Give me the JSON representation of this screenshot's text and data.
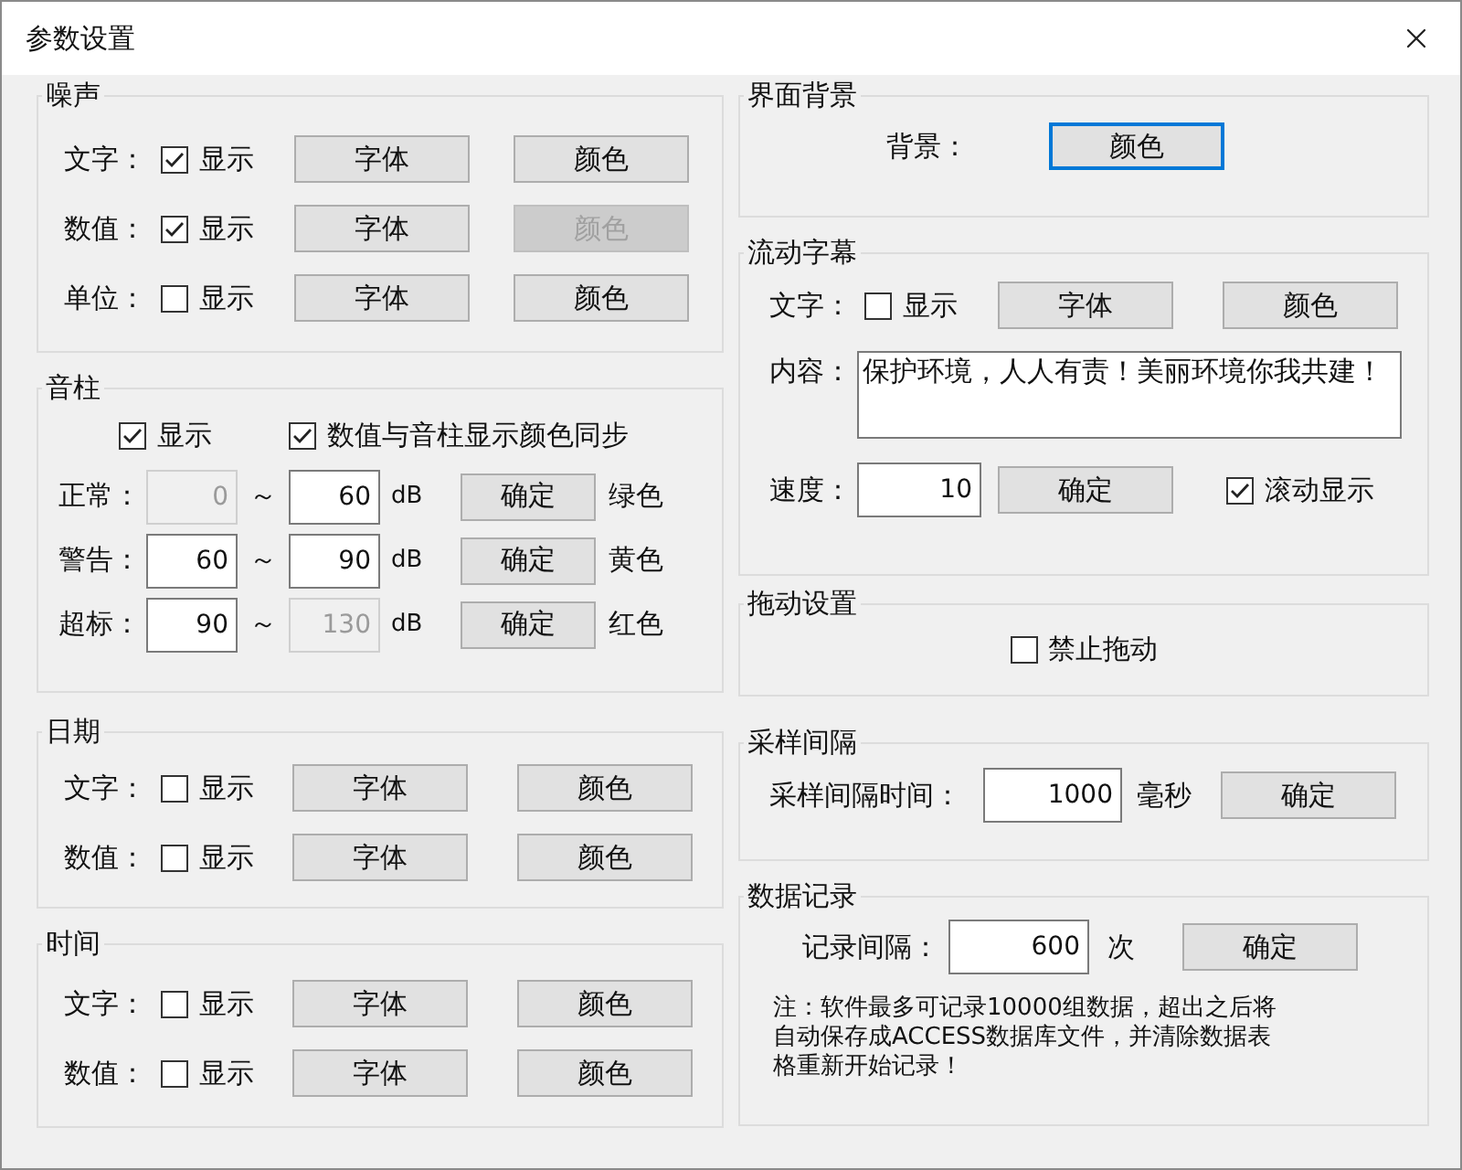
{
  "window": {
    "title": "参数设置"
  },
  "noise": {
    "title": "噪声",
    "rows": [
      {
        "label": "文字：",
        "show": {
          "label": "显示",
          "checked": true
        },
        "font_button": {
          "label": "字体",
          "disabled": false
        },
        "color_button": {
          "label": "颜色",
          "disabled": false
        }
      },
      {
        "label": "数值：",
        "show": {
          "label": "显示",
          "checked": true
        },
        "font_button": {
          "label": "字体",
          "disabled": false
        },
        "color_button": {
          "label": "颜色",
          "disabled": true
        }
      },
      {
        "label": "单位：",
        "show": {
          "label": "显示",
          "checked": false
        },
        "font_button": {
          "label": "字体",
          "disabled": false
        },
        "color_button": {
          "label": "颜色",
          "disabled": false
        }
      }
    ]
  },
  "bar": {
    "title": "音柱",
    "show": {
      "label": "显示",
      "checked": true
    },
    "sync": {
      "label": "数值与音柱显示颜色同步",
      "checked": true
    },
    "ranges": [
      {
        "label": "正常：",
        "low": {
          "value": "0",
          "disabled": true
        },
        "separator": "～",
        "high": {
          "value": "60",
          "disabled": false
        },
        "unit": "dB",
        "button": "确定",
        "color_name": "绿色"
      },
      {
        "label": "警告：",
        "low": {
          "value": "60",
          "disabled": false
        },
        "separator": "～",
        "high": {
          "value": "90",
          "disabled": false
        },
        "unit": "dB",
        "button": "确定",
        "color_name": "黄色"
      },
      {
        "label": "超标：",
        "low": {
          "value": "90",
          "disabled": false
        },
        "separator": "～",
        "high": {
          "value": "130",
          "disabled": true
        },
        "unit": "dB",
        "button": "确定",
        "color_name": "红色"
      }
    ]
  },
  "date": {
    "title": "日期",
    "rows": [
      {
        "label": "文字：",
        "show": {
          "label": "显示",
          "checked": false
        },
        "font_button": {
          "label": "字体",
          "disabled": false
        },
        "color_button": {
          "label": "颜色",
          "disabled": false
        }
      },
      {
        "label": "数值：",
        "show": {
          "label": "显示",
          "checked": false
        },
        "font_button": {
          "label": "字体",
          "disabled": false
        },
        "color_button": {
          "label": "颜色",
          "disabled": false
        }
      }
    ]
  },
  "time": {
    "title": "时间",
    "rows": [
      {
        "label": "文字：",
        "show": {
          "label": "显示",
          "checked": false
        },
        "font_button": {
          "label": "字体",
          "disabled": false
        },
        "color_button": {
          "label": "颜色",
          "disabled": false
        }
      },
      {
        "label": "数值：",
        "show": {
          "label": "显示",
          "checked": false
        },
        "font_button": {
          "label": "字体",
          "disabled": false
        },
        "color_button": {
          "label": "颜色",
          "disabled": false
        }
      }
    ]
  },
  "background": {
    "title": "界面背景",
    "label": "背景：",
    "button": {
      "label": "颜色",
      "focused": true
    }
  },
  "marquee": {
    "title": "流动字幕",
    "text_row": {
      "label": "文字：",
      "show": {
        "label": "显示",
        "checked": false
      },
      "font_button": {
        "label": "字体",
        "disabled": false
      },
      "color_button": {
        "label": "颜色",
        "disabled": false
      }
    },
    "content_label": "内容：",
    "content": "保护环境，人人有责！美丽环境你我共建！",
    "speed_label": "速度：",
    "speed": "10",
    "button": "确定",
    "scroll": {
      "label": "滚动显示",
      "checked": true
    }
  },
  "drag": {
    "title": "拖动设置",
    "forbid": {
      "label": "禁止拖动",
      "checked": false
    }
  },
  "sampling": {
    "title": "采样间隔",
    "label": "采样间隔时间：",
    "value": "1000",
    "unit": "毫秒",
    "button": "确定"
  },
  "record": {
    "title": "数据记录",
    "label": "记录间隔：",
    "value": "600",
    "unit": "次",
    "button": "确定",
    "note": "注：软件最多可记录10000组数据，超出之后将自动保存成ACCESS数据库文件，并清除数据表格重新开始记录！"
  }
}
